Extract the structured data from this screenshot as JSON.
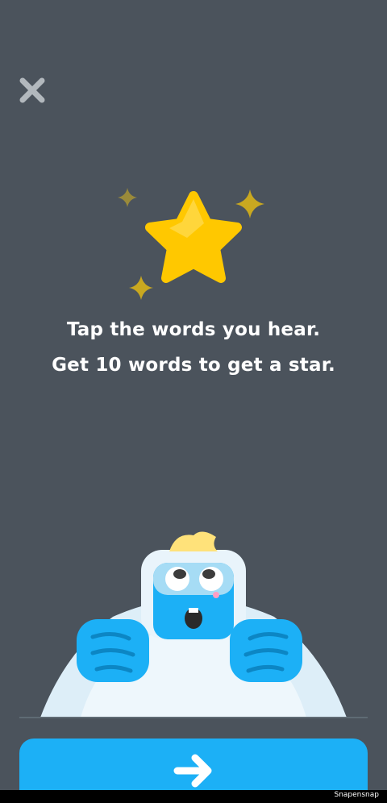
{
  "header": {
    "close_icon": "close-icon"
  },
  "illustration": {
    "star_icon": "star-icon",
    "sparkle_icon": "sparkle-icon",
    "star_color": "#ffc800"
  },
  "instructions": {
    "line1": "Tap the words you hear.",
    "line2": "Get 10 words to get a star."
  },
  "mascot": {
    "name": "yeti-mascot"
  },
  "footer": {
    "continue_icon": "arrow-right-icon",
    "button_color": "#1cb0f6"
  },
  "watermark": "Snapensnap"
}
